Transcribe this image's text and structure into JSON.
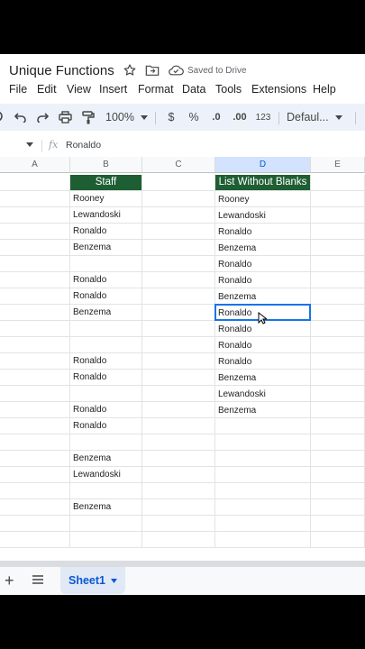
{
  "app": {
    "title": "Unique Functions",
    "save_status": "Saved to Drive"
  },
  "menu": [
    "File",
    "Edit",
    "View",
    "Insert",
    "Format",
    "Data",
    "Tools",
    "Extensions",
    "Help"
  ],
  "toolbar": {
    "zoom": "100%",
    "currency": "$",
    "percent": "%",
    "decrease_decimal": ".0",
    "increase_decimal": ".00",
    "number_format": "123",
    "font": "Defaul..."
  },
  "formula_bar": {
    "fx": "fx",
    "value": "Ronaldo"
  },
  "columns": [
    "A",
    "B",
    "C",
    "D",
    "E"
  ],
  "selected_column": "D",
  "staff_header": "Staff",
  "staff": [
    "Rooney",
    "Lewandoski",
    "Ronaldo",
    "Benzema",
    "",
    "Ronaldo",
    "Ronaldo",
    "Benzema",
    "",
    "",
    "Ronaldo",
    "Ronaldo",
    "",
    "Ronaldo",
    "Ronaldo",
    "",
    "Benzema",
    "Lewandoski",
    "",
    "Benzema"
  ],
  "result_header": "List Without Blanks",
  "result": [
    "Rooney",
    "Lewandoski",
    "Ronaldo",
    "Benzema",
    "Ronaldo",
    "Ronaldo",
    "Benzema",
    "Ronaldo",
    "Ronaldo",
    "Ronaldo",
    "Ronaldo",
    "Benzema",
    "Lewandoski",
    "Benzema"
  ],
  "active_result_index": 7,
  "sheets": {
    "add": "+",
    "active": "Sheet1"
  },
  "colors": {
    "header_fill": "#1e5e33",
    "selection": "#1a73e8",
    "toolbar_bg": "#edf2fa"
  }
}
